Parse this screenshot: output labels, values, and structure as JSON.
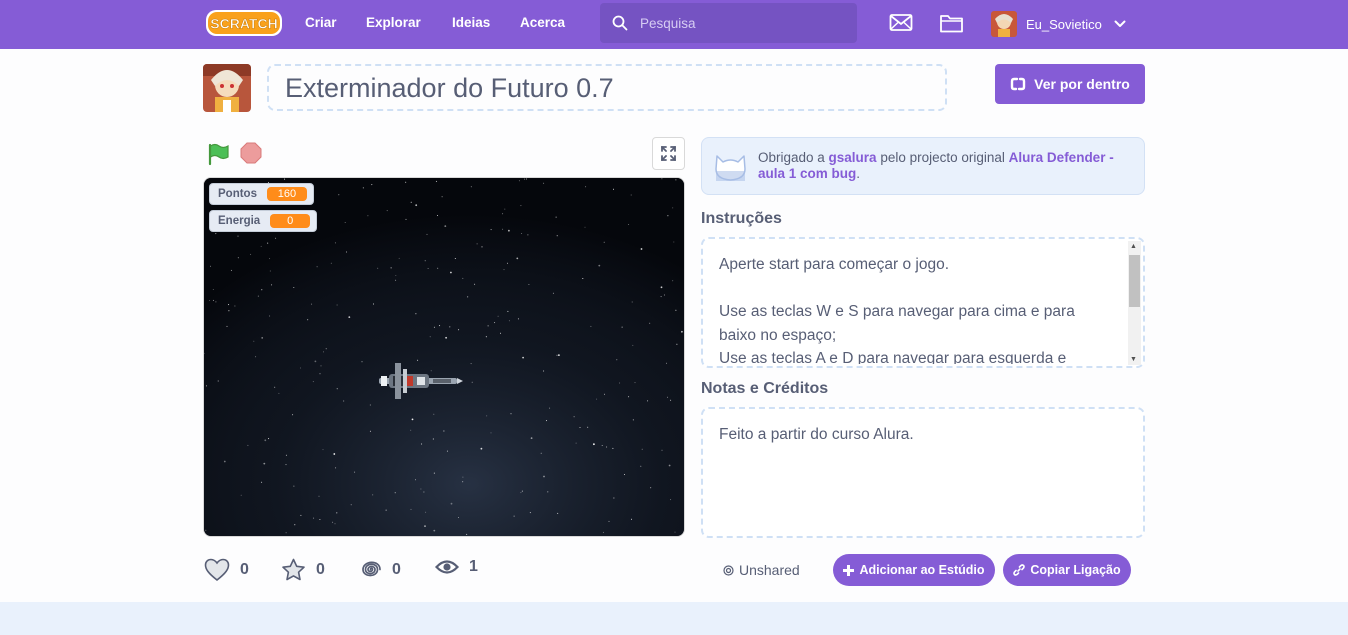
{
  "nav": {
    "logo_text": "SCRATCH",
    "links": [
      "Criar",
      "Explorar",
      "Ideias",
      "Acerca"
    ],
    "search_placeholder": "Pesquisa",
    "username": "Eu_Sovietico"
  },
  "project": {
    "title": "Exterminador do Futuro 0.7",
    "see_inside_label": "Ver por dentro"
  },
  "stage": {
    "monitors": [
      {
        "label": "Pontos",
        "value": "160"
      },
      {
        "label": "Energia",
        "value": "0"
      }
    ]
  },
  "stats": {
    "loves": "0",
    "favorites": "0",
    "remixes": "0",
    "views": "1"
  },
  "remix_credit": {
    "prefix": "Obrigado a ",
    "author": "gsalura",
    "middle": " pelo projecto original ",
    "original": "Alura Defender - aula 1 com bug",
    "suffix": "."
  },
  "instructions": {
    "label": "Instruções",
    "text": "Aperte start para começar o jogo.\n\nUse as teclas W e S para navegar para cima e para baixo no espaço;\nUse as teclas A e D para navegar para esquerda e"
  },
  "notes": {
    "label": "Notas e Créditos",
    "text": "Feito a partir do curso Alura."
  },
  "sharing": {
    "status": "Unshared",
    "add_studio_label": "Adicionar ao Estúdio",
    "copy_link_label": "Copiar Ligação"
  },
  "colors": {
    "brand": "#855cd6",
    "monitor_value": "#ff8c1a",
    "flag": "#4cbf56",
    "stop": "#ec9c9c"
  }
}
